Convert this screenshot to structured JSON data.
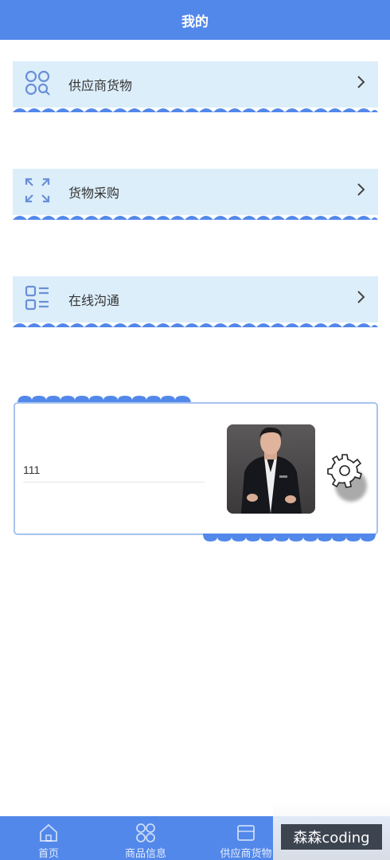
{
  "header": {
    "title": "我的"
  },
  "menu": [
    {
      "label": "供应商货物",
      "icon": "grid-search-icon"
    },
    {
      "label": "货物采购",
      "icon": "expand-arrows-icon"
    },
    {
      "label": "在线沟通",
      "icon": "list-icon"
    }
  ],
  "profile": {
    "name_value": "111",
    "avatar": "avatar-photo",
    "settings_icon": "gear-icon"
  },
  "tabbar": {
    "tabs": [
      {
        "label": "首页",
        "icon": "home-icon"
      },
      {
        "label": "商品信息",
        "icon": "grid-circles-icon"
      },
      {
        "label": "供应商货物",
        "icon": "box-icon"
      }
    ]
  },
  "watermark": {
    "text": "森森coding"
  },
  "colors": {
    "primary": "#5288ea",
    "menu_bg": "#dceefa",
    "icon": "#6a8fd8"
  }
}
